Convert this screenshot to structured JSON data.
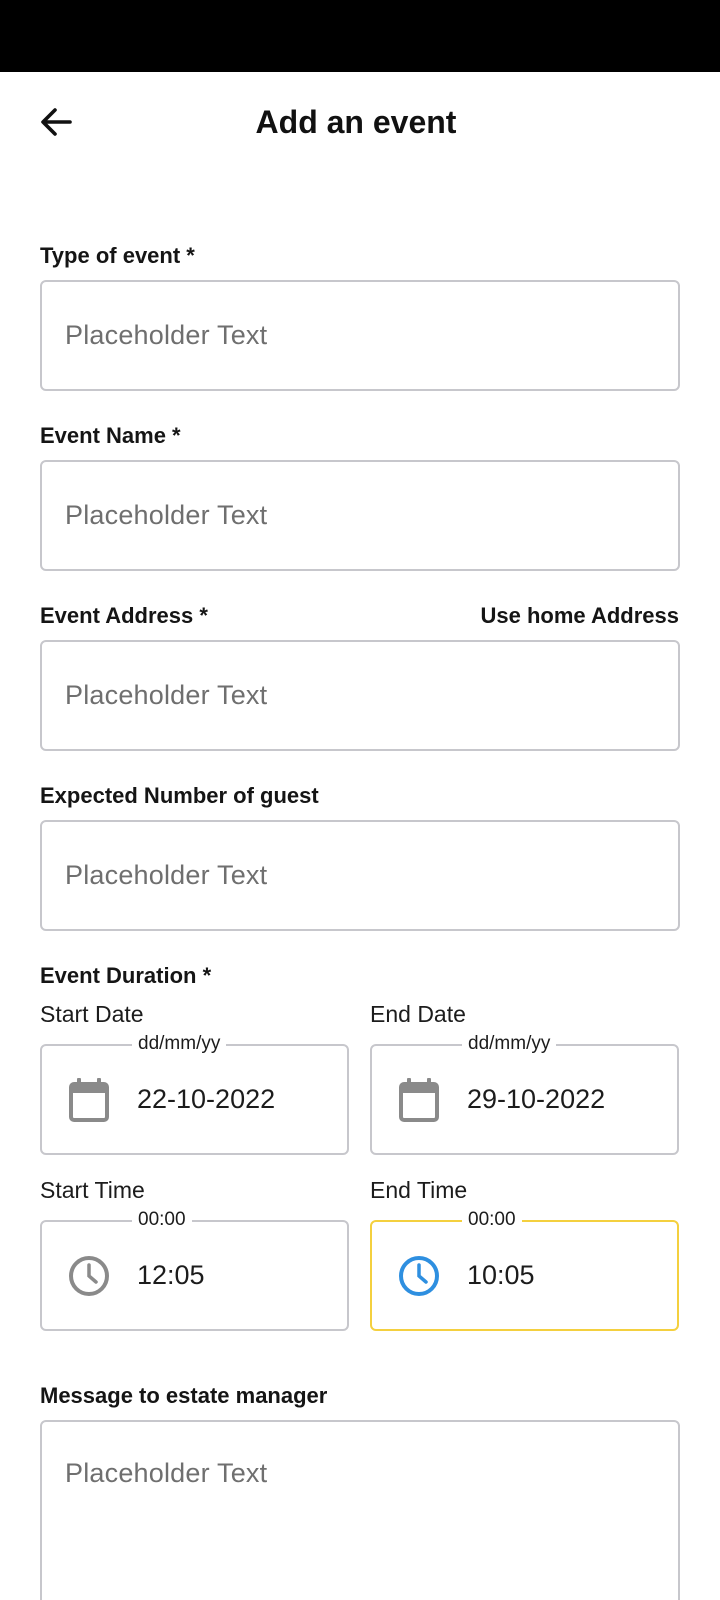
{
  "header": {
    "title": "Add an event",
    "back_icon": "arrow-left-icon"
  },
  "form": {
    "type_of_event": {
      "label": "Type of event *",
      "placeholder": "Placeholder Text"
    },
    "event_name": {
      "label": "Event Name *",
      "placeholder": "Placeholder Text"
    },
    "event_address": {
      "label": "Event Address *",
      "link": "Use home Address",
      "placeholder": "Placeholder Text"
    },
    "expected_guests": {
      "label": "Expected Number of guest",
      "placeholder": "Placeholder Text"
    },
    "duration": {
      "label": "Event Duration *",
      "start_date": {
        "label": "Start Date",
        "hint": "dd/mm/yy",
        "value": "22-10-2022",
        "icon": "calendar-icon"
      },
      "end_date": {
        "label": "End Date",
        "hint": "dd/mm/yy",
        "value": "29-10-2022",
        "icon": "calendar-icon"
      },
      "start_time": {
        "label": "Start Time",
        "hint": "00:00",
        "value": "12:05",
        "icon": "clock-icon"
      },
      "end_time": {
        "label": "End Time",
        "hint": "00:00",
        "value": "10:05",
        "icon": "clock-icon"
      }
    },
    "message": {
      "label": "Message to estate manager",
      "placeholder": "Placeholder Text"
    }
  },
  "colors": {
    "focus_border": "#f4d03f",
    "active_icon": "#2e8fe0",
    "inactive_icon": "#8a8a8a",
    "border": "#c7c7cc"
  }
}
